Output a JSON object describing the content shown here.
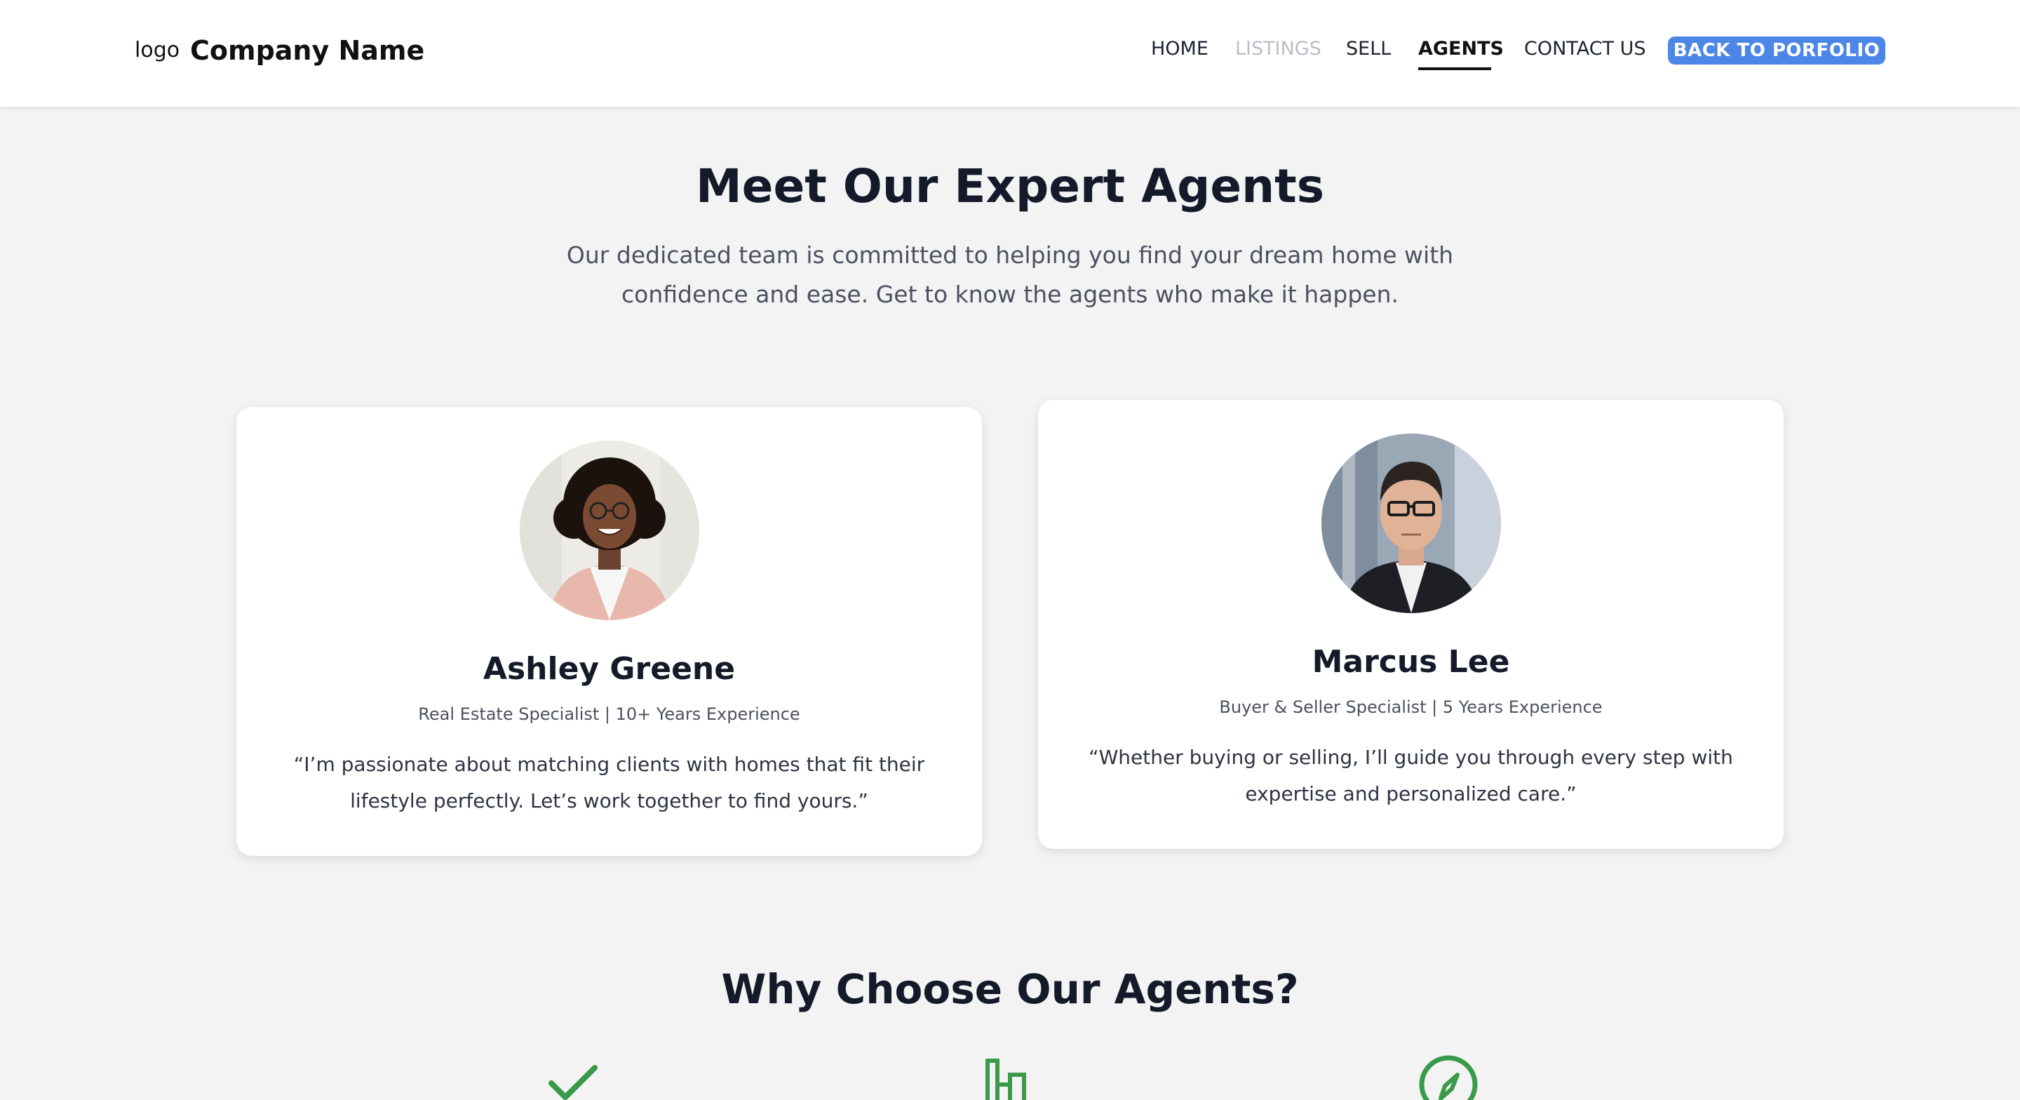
{
  "header": {
    "logo": "logo",
    "company": "Company Name",
    "nav": {
      "home": "HOME",
      "listings": "LISTINGS",
      "sell": "SELL",
      "agents": "AGENTS",
      "contact": "CONTACT US"
    },
    "cta": "BACK TO PORFOLIO",
    "accent": "#4c86e6"
  },
  "hero": {
    "title": "Meet Our Expert Agents",
    "subtitle": "Our dedicated team is committed to helping you find your dream home with confidence and ease. Get to know the agents who make it happen."
  },
  "agents": [
    {
      "name": "Ashley Greene",
      "role": "Real Estate Specialist | 10+ Years Experience",
      "quote": "“I’m passionate about matching clients with homes that fit their lifestyle perfectly. Let’s work together to find yours.”",
      "photo": "woman-portrait"
    },
    {
      "name": "Marcus Lee",
      "role": "Buyer & Seller Specialist | 5 Years Experience",
      "quote": "“Whether buying or selling, I’ll guide you through every step with expertise and personalized care.”",
      "photo": "man-portrait"
    }
  ],
  "why": {
    "title": "Why Choose Our Agents?",
    "icons": [
      "checkmark-icon",
      "city-buildings-icon",
      "compass-icon"
    ],
    "icon_color": "#3a9a48"
  }
}
